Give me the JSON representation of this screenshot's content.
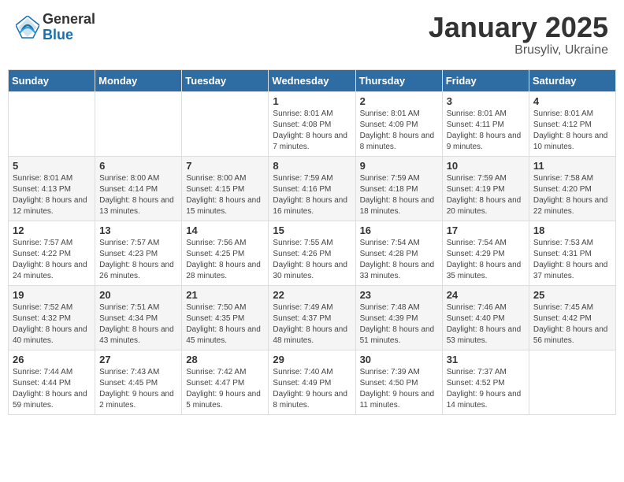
{
  "header": {
    "logo_general": "General",
    "logo_blue": "Blue",
    "month_title": "January 2025",
    "location": "Brusyliv, Ukraine"
  },
  "weekdays": [
    "Sunday",
    "Monday",
    "Tuesday",
    "Wednesday",
    "Thursday",
    "Friday",
    "Saturday"
  ],
  "weeks": [
    [
      {
        "day": "",
        "info": ""
      },
      {
        "day": "",
        "info": ""
      },
      {
        "day": "",
        "info": ""
      },
      {
        "day": "1",
        "info": "Sunrise: 8:01 AM\nSunset: 4:08 PM\nDaylight: 8 hours\nand 7 minutes."
      },
      {
        "day": "2",
        "info": "Sunrise: 8:01 AM\nSunset: 4:09 PM\nDaylight: 8 hours\nand 8 minutes."
      },
      {
        "day": "3",
        "info": "Sunrise: 8:01 AM\nSunset: 4:11 PM\nDaylight: 8 hours\nand 9 minutes."
      },
      {
        "day": "4",
        "info": "Sunrise: 8:01 AM\nSunset: 4:12 PM\nDaylight: 8 hours\nand 10 minutes."
      }
    ],
    [
      {
        "day": "5",
        "info": "Sunrise: 8:01 AM\nSunset: 4:13 PM\nDaylight: 8 hours\nand 12 minutes."
      },
      {
        "day": "6",
        "info": "Sunrise: 8:00 AM\nSunset: 4:14 PM\nDaylight: 8 hours\nand 13 minutes."
      },
      {
        "day": "7",
        "info": "Sunrise: 8:00 AM\nSunset: 4:15 PM\nDaylight: 8 hours\nand 15 minutes."
      },
      {
        "day": "8",
        "info": "Sunrise: 7:59 AM\nSunset: 4:16 PM\nDaylight: 8 hours\nand 16 minutes."
      },
      {
        "day": "9",
        "info": "Sunrise: 7:59 AM\nSunset: 4:18 PM\nDaylight: 8 hours\nand 18 minutes."
      },
      {
        "day": "10",
        "info": "Sunrise: 7:59 AM\nSunset: 4:19 PM\nDaylight: 8 hours\nand 20 minutes."
      },
      {
        "day": "11",
        "info": "Sunrise: 7:58 AM\nSunset: 4:20 PM\nDaylight: 8 hours\nand 22 minutes."
      }
    ],
    [
      {
        "day": "12",
        "info": "Sunrise: 7:57 AM\nSunset: 4:22 PM\nDaylight: 8 hours\nand 24 minutes."
      },
      {
        "day": "13",
        "info": "Sunrise: 7:57 AM\nSunset: 4:23 PM\nDaylight: 8 hours\nand 26 minutes."
      },
      {
        "day": "14",
        "info": "Sunrise: 7:56 AM\nSunset: 4:25 PM\nDaylight: 8 hours\nand 28 minutes."
      },
      {
        "day": "15",
        "info": "Sunrise: 7:55 AM\nSunset: 4:26 PM\nDaylight: 8 hours\nand 30 minutes."
      },
      {
        "day": "16",
        "info": "Sunrise: 7:54 AM\nSunset: 4:28 PM\nDaylight: 8 hours\nand 33 minutes."
      },
      {
        "day": "17",
        "info": "Sunrise: 7:54 AM\nSunset: 4:29 PM\nDaylight: 8 hours\nand 35 minutes."
      },
      {
        "day": "18",
        "info": "Sunrise: 7:53 AM\nSunset: 4:31 PM\nDaylight: 8 hours\nand 37 minutes."
      }
    ],
    [
      {
        "day": "19",
        "info": "Sunrise: 7:52 AM\nSunset: 4:32 PM\nDaylight: 8 hours\nand 40 minutes."
      },
      {
        "day": "20",
        "info": "Sunrise: 7:51 AM\nSunset: 4:34 PM\nDaylight: 8 hours\nand 43 minutes."
      },
      {
        "day": "21",
        "info": "Sunrise: 7:50 AM\nSunset: 4:35 PM\nDaylight: 8 hours\nand 45 minutes."
      },
      {
        "day": "22",
        "info": "Sunrise: 7:49 AM\nSunset: 4:37 PM\nDaylight: 8 hours\nand 48 minutes."
      },
      {
        "day": "23",
        "info": "Sunrise: 7:48 AM\nSunset: 4:39 PM\nDaylight: 8 hours\nand 51 minutes."
      },
      {
        "day": "24",
        "info": "Sunrise: 7:46 AM\nSunset: 4:40 PM\nDaylight: 8 hours\nand 53 minutes."
      },
      {
        "day": "25",
        "info": "Sunrise: 7:45 AM\nSunset: 4:42 PM\nDaylight: 8 hours\nand 56 minutes."
      }
    ],
    [
      {
        "day": "26",
        "info": "Sunrise: 7:44 AM\nSunset: 4:44 PM\nDaylight: 8 hours\nand 59 minutes."
      },
      {
        "day": "27",
        "info": "Sunrise: 7:43 AM\nSunset: 4:45 PM\nDaylight: 9 hours\nand 2 minutes."
      },
      {
        "day": "28",
        "info": "Sunrise: 7:42 AM\nSunset: 4:47 PM\nDaylight: 9 hours\nand 5 minutes."
      },
      {
        "day": "29",
        "info": "Sunrise: 7:40 AM\nSunset: 4:49 PM\nDaylight: 9 hours\nand 8 minutes."
      },
      {
        "day": "30",
        "info": "Sunrise: 7:39 AM\nSunset: 4:50 PM\nDaylight: 9 hours\nand 11 minutes."
      },
      {
        "day": "31",
        "info": "Sunrise: 7:37 AM\nSunset: 4:52 PM\nDaylight: 9 hours\nand 14 minutes."
      },
      {
        "day": "",
        "info": ""
      }
    ]
  ]
}
